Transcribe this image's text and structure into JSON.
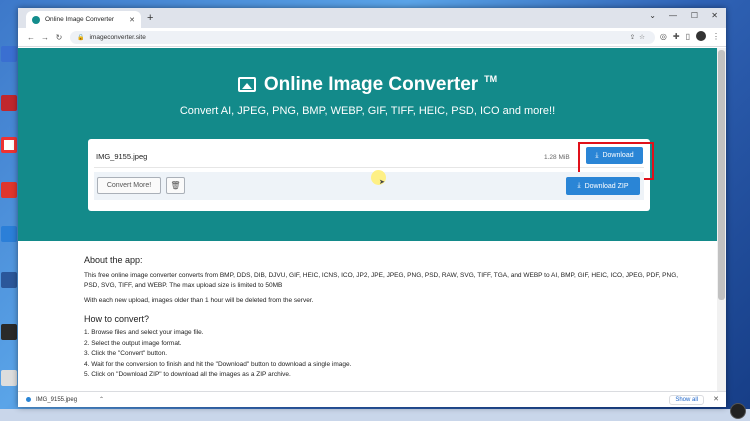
{
  "browser": {
    "tab_title": "Online Image Converter",
    "tab_close": "✕",
    "new_tab": "+",
    "url": "imageconverter.site",
    "window_controls": [
      "⌄",
      "—",
      "☐",
      "✕"
    ]
  },
  "hero": {
    "title": "Online Image Converter",
    "trademark": "TM",
    "subtitle": "Convert AI, JPEG, PNG, BMP, WEBP, GIF, TIFF, HEIC, PSD, ICO and more!!"
  },
  "file": {
    "name": "IMG_9155.jpeg",
    "size": "1.28 MiB",
    "download_label": "Download"
  },
  "actions": {
    "convert_label": "Convert More!",
    "zip_label": "Download ZIP"
  },
  "about": {
    "heading": "About the app:",
    "description": "This free online image converter converts from BMP, DDS, DIB, DJVU, GIF, HEIC, ICNS, ICO, JP2, JPE, JPEG, PNG, PSD, RAW, SVG, TIFF, TGA, and WEBP to AI, BMP, GIF, HEIC, ICO, JPEG, PDF, PNG, PSD, SVG, TIFF, and WEBP. The max upload size is limited to 50MB",
    "retention": "With each new upload, images older than 1 hour will be deleted from the server.",
    "howto_heading": "How to convert?",
    "steps": [
      "1. Browse files and select your image file.",
      "2. Select the output image format.",
      "3. Click the \"Convert\" button.",
      "4. Wait for the conversion to finish and hit the \"Download\" button to download a single image.",
      "5. Click on \"Download ZIP\" to download all the images as a ZIP archive."
    ]
  },
  "download_bar": {
    "filename": "IMG_9155.jpeg",
    "show_all": "Show all"
  },
  "colors": {
    "hero_bg": "#138a8a",
    "button_blue": "#2a85d6",
    "highlight_red": "#e0101a"
  }
}
